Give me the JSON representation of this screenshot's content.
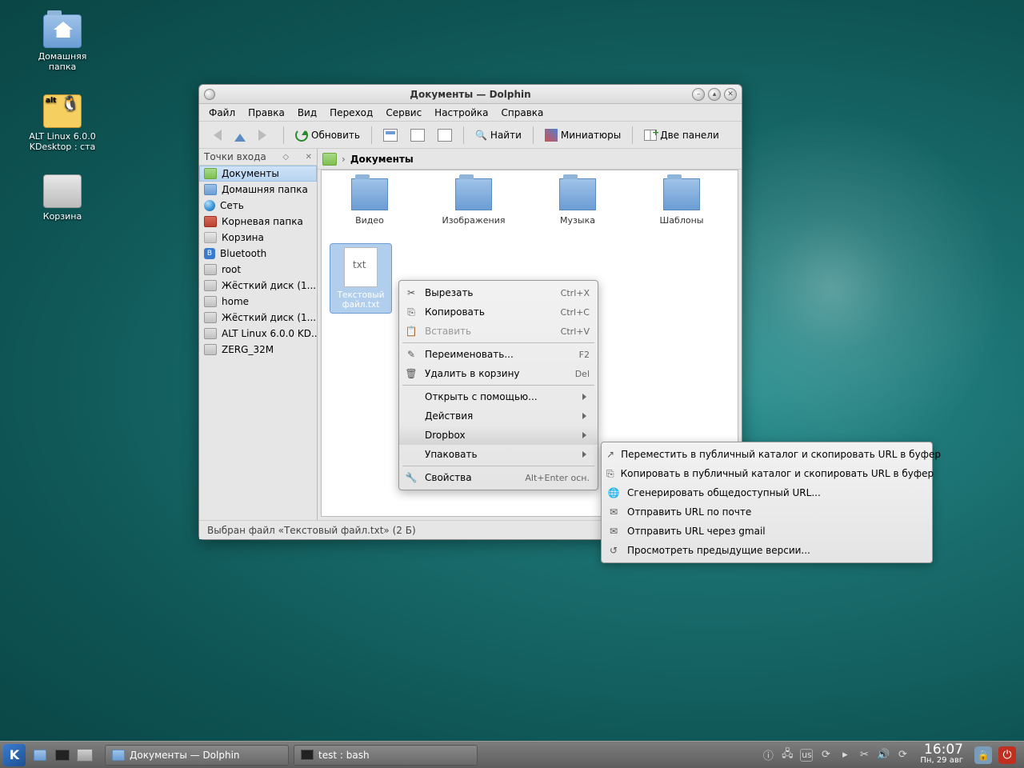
{
  "desktop_icons": [
    {
      "label": "Домашняя\nпапка",
      "name": "home-folder"
    },
    {
      "label": "ALT Linux 6.0.0\nKDesktop : ста",
      "name": "alt-linux"
    },
    {
      "label": "Корзина",
      "name": "trash"
    }
  ],
  "window": {
    "title": "Документы — Dolphin",
    "menubar": [
      "Файл",
      "Правка",
      "Вид",
      "Переход",
      "Сервис",
      "Настройка",
      "Справка"
    ],
    "toolbar": {
      "refresh": "Обновить",
      "find": "Найти",
      "thumbs": "Миниатюры",
      "split": "Две панели"
    },
    "side_header": "Точки входа",
    "side_items": [
      {
        "label": "Документы",
        "cls": "sf-g",
        "sel": true
      },
      {
        "label": "Домашняя папка",
        "cls": "sf-b"
      },
      {
        "label": "Сеть",
        "cls": "sf-gl"
      },
      {
        "label": "Корневая папка",
        "cls": "sf-r"
      },
      {
        "label": "Корзина",
        "cls": "sf-t"
      },
      {
        "label": "Bluetooth",
        "cls": "sf-bt"
      },
      {
        "label": "root",
        "cls": "sf-d"
      },
      {
        "label": "Жёсткий диск (1...",
        "cls": "sf-d"
      },
      {
        "label": "home",
        "cls": "sf-d"
      },
      {
        "label": "Жёсткий диск (1...",
        "cls": "sf-d"
      },
      {
        "label": "ALT Linux 6.0.0 KD...",
        "cls": "sf-d"
      },
      {
        "label": "ZERG_32M",
        "cls": "sf-d"
      }
    ],
    "breadcrumb": "Документы",
    "folders": [
      "Видео",
      "Изображения",
      "Музыка",
      "Шаблоны"
    ],
    "selected_file": "Текстовый файл.txt",
    "status": "Выбран файл «Текстовый файл.txt» (2 Б)"
  },
  "ctx1": [
    {
      "icon": "✂",
      "label": "Вырезать",
      "sc": "Ctrl+X"
    },
    {
      "icon": "⎘",
      "label": "Копировать",
      "sc": "Ctrl+C"
    },
    {
      "icon": "📋",
      "label": "Вставить",
      "sc": "Ctrl+V",
      "dis": true
    },
    {
      "sep": true
    },
    {
      "icon": "✎",
      "label": "Переименовать...",
      "sc": "F2"
    },
    {
      "icon": "🗑",
      "label": "Удалить в корзину",
      "sc": "Del"
    },
    {
      "sep": true
    },
    {
      "label": "Открыть с помощью...",
      "sub": true
    },
    {
      "label": "Действия",
      "sub": true
    },
    {
      "label": "Dropbox",
      "sub": true,
      "hov": true
    },
    {
      "label": "Упаковать",
      "sub": true
    },
    {
      "sep": true
    },
    {
      "icon": "🔧",
      "label": "Свойства",
      "sc": "Alt+Enter осн."
    }
  ],
  "ctx2": [
    {
      "icon": "↗",
      "label": "Переместить в публичный каталог и скопировать URL в буфер"
    },
    {
      "icon": "⎘",
      "label": "Копировать в публичный каталог и скопировать URL в буфер"
    },
    {
      "icon": "🌐",
      "label": "Сгенерировать общедоступный URL..."
    },
    {
      "icon": "✉",
      "label": "Отправить URL по почте"
    },
    {
      "icon": "✉",
      "label": "Отправить URL через gmail"
    },
    {
      "icon": "↺",
      "label": "Просмотреть предыдущие версии..."
    }
  ],
  "taskbar": {
    "tasks": [
      {
        "label": "Документы — Dolphin",
        "icon": "sf-b"
      },
      {
        "label": "test : bash",
        "icon": "term"
      }
    ],
    "kb": "us",
    "time": "16:07",
    "date": "Пн, 29 авг"
  }
}
